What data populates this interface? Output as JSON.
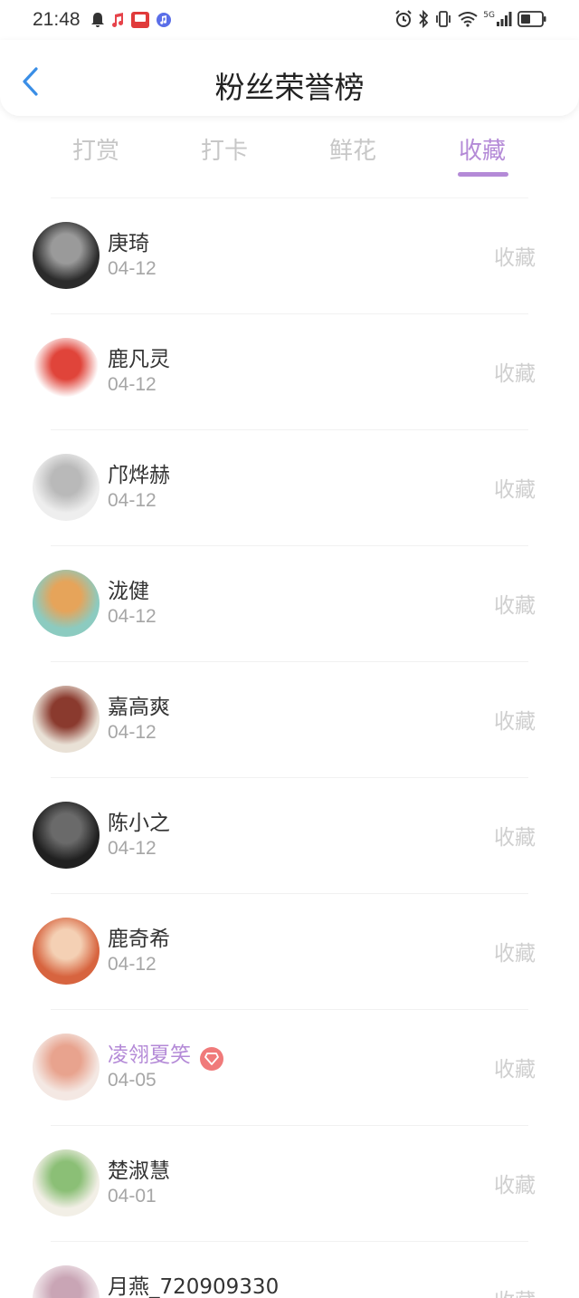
{
  "status_bar": {
    "time": "21:48",
    "network": "5G",
    "left_icons": [
      "bell-icon",
      "music-icon",
      "app-icon",
      "music-app-icon"
    ],
    "right_icons": [
      "alarm-icon",
      "bluetooth-icon",
      "vibrate-icon",
      "wifi-icon",
      "signal-icon",
      "battery-icon"
    ]
  },
  "header": {
    "title": "粉丝荣誉榜",
    "back_icon": "chevron-left-icon"
  },
  "tabs": [
    {
      "label": "打赏",
      "active": false
    },
    {
      "label": "打卡",
      "active": false
    },
    {
      "label": "鲜花",
      "active": false
    },
    {
      "label": "收藏",
      "active": true
    }
  ],
  "colors": {
    "accent": "#b48ad7",
    "vip_badge": "#f07a7a"
  },
  "list": [
    {
      "name": "庚琦",
      "date": "04-12",
      "action": "收藏",
      "avatar_colors": [
        "#2b2b2b",
        "#9a9a9a"
      ]
    },
    {
      "name": "鹿凡灵",
      "date": "04-12",
      "action": "收藏",
      "avatar_colors": [
        "#ffffff",
        "#e0443a"
      ]
    },
    {
      "name": "邝烨赫",
      "date": "04-12",
      "action": "收藏",
      "avatar_colors": [
        "#eeeeee",
        "#b9b9b9"
      ]
    },
    {
      "name": "泷健",
      "date": "04-12",
      "action": "收藏",
      "avatar_colors": [
        "#8ccbc0",
        "#e6a45a"
      ]
    },
    {
      "name": "嘉高爽",
      "date": "04-12",
      "action": "收藏",
      "avatar_colors": [
        "#e9e1d6",
        "#8a3a2e"
      ]
    },
    {
      "name": "陈小之",
      "date": "04-12",
      "action": "收藏",
      "avatar_colors": [
        "#202020",
        "#6a6a6a"
      ]
    },
    {
      "name": "鹿奇希",
      "date": "04-12",
      "action": "收藏",
      "avatar_colors": [
        "#d7643f",
        "#f4d0b4"
      ]
    },
    {
      "name": "凌翎夏笑",
      "date": "04-05",
      "action": "收藏",
      "vip": true,
      "avatar_colors": [
        "#f4e8e3",
        "#e8a38e"
      ]
    },
    {
      "name": "楚淑慧",
      "date": "04-01",
      "action": "收藏",
      "avatar_colors": [
        "#f2efe6",
        "#8bbf76"
      ]
    },
    {
      "name": "月燕_720909330",
      "date": "",
      "action": "收藏",
      "avatar_colors": [
        "#f0e6ea",
        "#c9a5b5"
      ]
    }
  ]
}
